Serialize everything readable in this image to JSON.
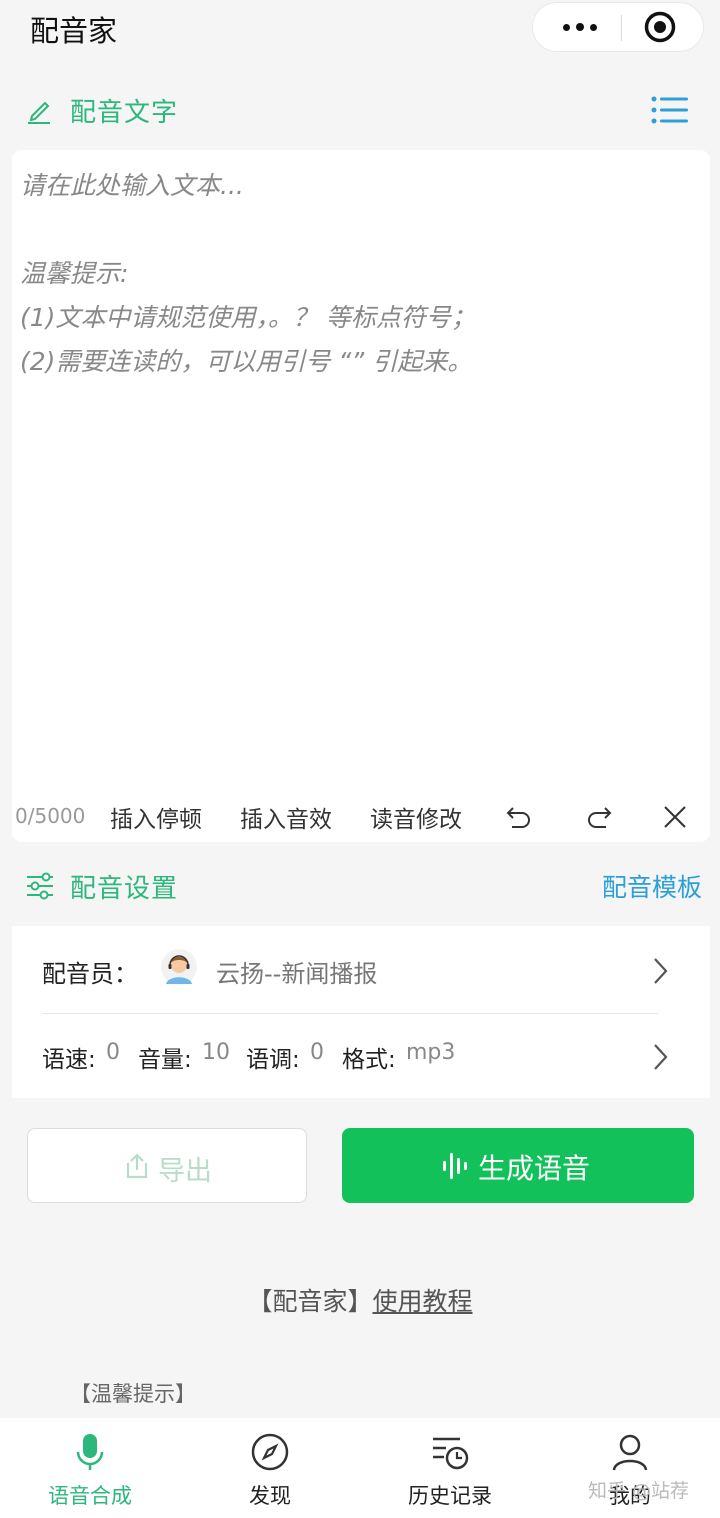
{
  "app": {
    "title": "配音家"
  },
  "text_section": {
    "title": "配音文字"
  },
  "editor": {
    "placeholder_lines": [
      "请在此处输入文本...",
      "",
      "温馨提示:",
      "(1)文本中请规范使用，。？ 等标点符号；",
      "(2)需要连读的，可以用引号 “” 引起来。"
    ],
    "char_count": "0/5000",
    "insert_pause": "插入停顿",
    "insert_sfx": "插入音效",
    "pronunciation": "读音修改"
  },
  "settings_section": {
    "title": "配音设置",
    "template_link": "配音模板"
  },
  "voice": {
    "label": "配音员：",
    "value": "云扬--新闻播报"
  },
  "params": {
    "speed_label": "语速:",
    "speed_value": "0",
    "volume_label": "音量:",
    "volume_value": "10",
    "pitch_label": "语调:",
    "pitch_value": "0",
    "format_label": "格式:",
    "format_value": "mp3"
  },
  "actions": {
    "export_label": "导出",
    "generate_label": "生成语音"
  },
  "tutorial": {
    "prefix": "【配音家】",
    "link": "使用教程"
  },
  "tips_heading": "【温馨提示】",
  "tabs": [
    {
      "label": "语音合成",
      "icon": "microphone-icon"
    },
    {
      "label": "发现",
      "icon": "compass-icon"
    },
    {
      "label": "历史记录",
      "icon": "history-icon"
    },
    {
      "label": "我的",
      "icon": "user-icon"
    }
  ],
  "watermark": "知乎 @站荐",
  "colors": {
    "accent_green": "#2cb77d",
    "primary_button": "#13c15a",
    "link_blue": "#2a9fd8"
  }
}
